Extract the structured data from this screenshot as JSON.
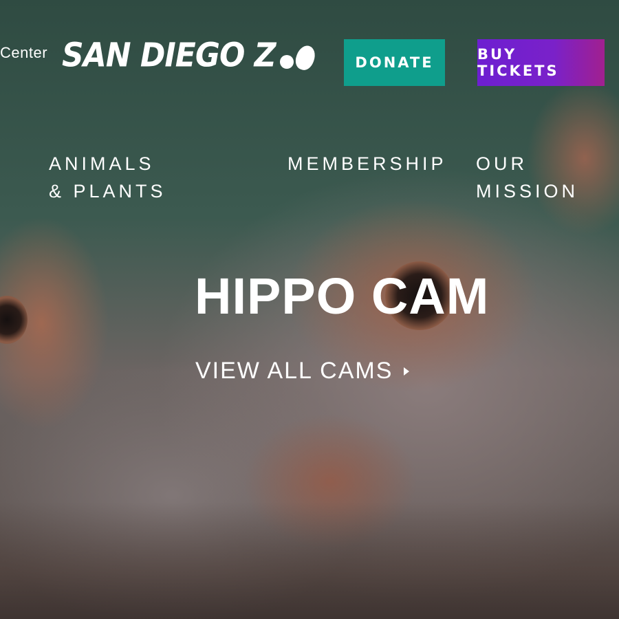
{
  "header": {
    "left_link": "Center",
    "logo_text": "SAN DIEGO Z",
    "donate_label": "DONATE",
    "tickets_label": "BUY TICKETS"
  },
  "nav": {
    "items": [
      {
        "label": "ANIMALS & PLANTS"
      },
      {
        "label": "MEMBERSHIP"
      },
      {
        "label": "OUR MISSION"
      }
    ]
  },
  "hero": {
    "title": "HIPPO CAM",
    "link_label": "VIEW ALL CAMS"
  },
  "colors": {
    "donate": "#0f9e8c",
    "tickets_start": "#6d1fd1",
    "tickets_end": "#a1208f"
  },
  "icons": {
    "view_all_arrow": "triangle-right-icon"
  }
}
